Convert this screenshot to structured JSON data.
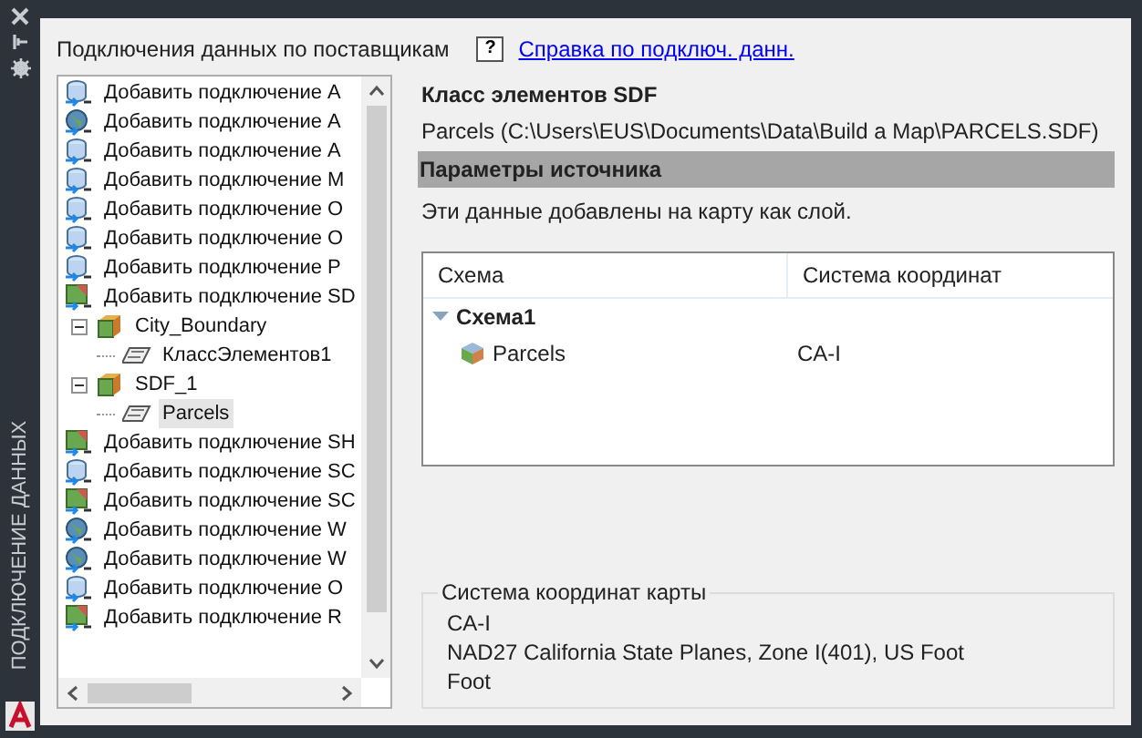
{
  "palette": {
    "title": "ПОДКЛЮЧЕНИЕ ДАННЫХ"
  },
  "header": {
    "title": "Подключения данных по поставщикам",
    "help_icon": "?",
    "help_link": "Справка по подключ. данн."
  },
  "tree": {
    "items": [
      {
        "kind": "database",
        "label": "Добавить подключение A",
        "selected": false
      },
      {
        "kind": "globe",
        "label": "Добавить подключение A",
        "selected": false
      },
      {
        "kind": "database",
        "label": "Добавить подключение A",
        "selected": false
      },
      {
        "kind": "database",
        "label": "Добавить подключение M",
        "selected": false
      },
      {
        "kind": "database",
        "label": "Добавить подключение O",
        "selected": false
      },
      {
        "kind": "database",
        "label": "Добавить подключение O",
        "selected": false
      },
      {
        "kind": "database",
        "label": "Добавить подключение P",
        "selected": false
      },
      {
        "kind": "file",
        "label": "Добавить подключение SD",
        "selected": false
      },
      {
        "kind": "connection",
        "label": "City_Boundary",
        "selected": false,
        "expanded": true,
        "children": [
          {
            "kind": "feature_class",
            "label": "КлассЭлементов1",
            "selected": false
          }
        ]
      },
      {
        "kind": "connection",
        "label": "SDF_1",
        "selected": false,
        "expanded": true,
        "children": [
          {
            "kind": "feature_class",
            "label": "Parcels",
            "selected": true
          }
        ]
      },
      {
        "kind": "file",
        "label": "Добавить подключение SH",
        "selected": false
      },
      {
        "kind": "database",
        "label": "Добавить подключение SC",
        "selected": false
      },
      {
        "kind": "file",
        "label": "Добавить подключение SC",
        "selected": false
      },
      {
        "kind": "globe",
        "label": "Добавить подключение W",
        "selected": false
      },
      {
        "kind": "globe",
        "label": "Добавить подключение W",
        "selected": false
      },
      {
        "kind": "database",
        "label": "Добавить подключение O",
        "selected": false
      },
      {
        "kind": "file",
        "label": "Добавить подключение R",
        "selected": false
      }
    ]
  },
  "details": {
    "heading": "Класс элементов SDF",
    "path": "Parcels (C:\\Users\\EUS\\Documents\\Data\\Build a Map\\PARCELS.SDF)",
    "section_title": "Параметры источника",
    "note": "Эти данные добавлены на карту как слой.",
    "table": {
      "columns": [
        "Схема",
        "Система координат"
      ],
      "rows": [
        {
          "kind": "schema",
          "name": "Схема1",
          "expanded": true
        },
        {
          "kind": "class",
          "name": "Parcels",
          "coordinate_system": "CA-I"
        }
      ]
    },
    "map_coordinate_system": {
      "title": "Система координат карты",
      "lines": [
        "CA-I",
        "NAD27 California State Planes, Zone I(401), US Foot",
        "Foot"
      ]
    }
  }
}
